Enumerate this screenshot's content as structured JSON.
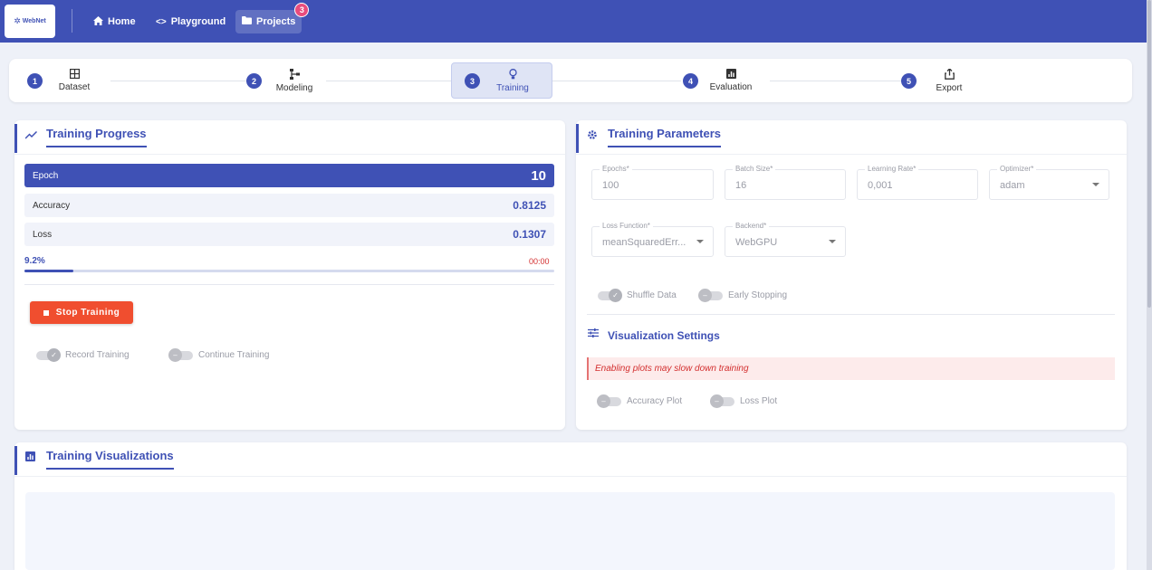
{
  "nav": {
    "logo_text": "WebNet",
    "home": "Home",
    "playground": "Playground",
    "projects": "Projects",
    "projects_badge": "3"
  },
  "stepper": {
    "steps": [
      {
        "num": "1",
        "label": "Dataset"
      },
      {
        "num": "2",
        "label": "Modeling"
      },
      {
        "num": "3",
        "label": "Training"
      },
      {
        "num": "4",
        "label": "Evaluation"
      },
      {
        "num": "5",
        "label": "Export"
      }
    ],
    "active_step": 3
  },
  "progress": {
    "title": "Training Progress",
    "epoch_label": "Epoch",
    "epoch_value": "10",
    "accuracy_label": "Accuracy",
    "accuracy_value": "0.8125",
    "loss_label": "Loss",
    "loss_value": "0.1307",
    "percent_text": "9.2%",
    "percent_fraction": 0.092,
    "timer": "00:00",
    "stop_label": "Stop Training",
    "record_label": "Record Training",
    "continue_label": "Continue Training",
    "record_on": true,
    "continue_on": false
  },
  "params": {
    "title": "Training Parameters",
    "epochs_label": "Epochs*",
    "epochs_value": "100",
    "batch_label": "Batch Size*",
    "batch_value": "16",
    "lr_label": "Learning Rate*",
    "lr_value": "0,001",
    "optimizer_label": "Optimizer*",
    "optimizer_value": "adam",
    "loss_fn_label": "Loss Function*",
    "loss_fn_value": "meanSquaredErr...",
    "backend_label": "Backend*",
    "backend_value": "WebGPU",
    "shuffle_label": "Shuffle Data",
    "early_label": "Early Stopping",
    "shuffle_on": true,
    "early_on": false
  },
  "viz_settings": {
    "title": "Visualization Settings",
    "warning": "Enabling plots may slow down training",
    "accuracy_plot_label": "Accuracy Plot",
    "loss_plot_label": "Loss Plot",
    "accuracy_plot_on": false,
    "loss_plot_on": false
  },
  "visualizations": {
    "title": "Training Visualizations"
  },
  "colors": {
    "primary": "#3f51b5",
    "danger": "#f04e2f",
    "badge": "#e84c7d"
  }
}
